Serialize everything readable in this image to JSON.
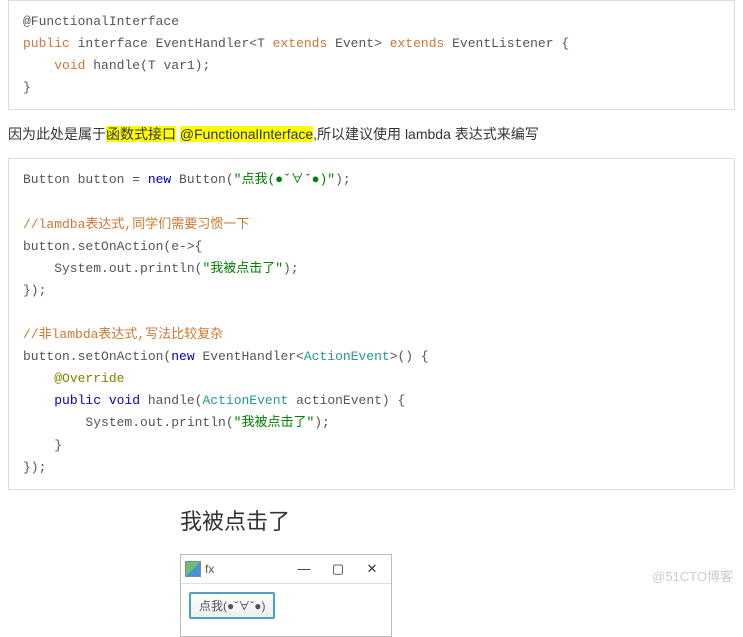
{
  "code1": {
    "l1_anno": "@FunctionalInterface",
    "l2a": "public",
    "l2b": " interface ",
    "l2c": "EventHandler",
    "l2d": "<T ",
    "l2e": "extends",
    "l2f": " Event> ",
    "l2g": "extends",
    "l2h": " EventListener {",
    "l3a": "    ",
    "l3b": "void",
    "l3c": " ",
    "l3d": "handle",
    "l3e": "(T var1);",
    "l4": "}"
  },
  "para1": {
    "pre": "因为此处是属于",
    "hl1": "函数式接口",
    "sp": " ",
    "hl2": "@FunctionalInterface",
    "post": ",所以建议使用 lambda 表达式来编写"
  },
  "code2": {
    "l1a": "Button button = ",
    "l1b": "new",
    "l1c": " Button(",
    "l1d": "\"点我(●ˇ∀ˇ●)\"",
    "l1e": ");",
    "blank": "",
    "c1a": "//lamdba表达式,同学们需要习惯一下",
    "l3a": "button.setOnAction(e->{",
    "l4a": "    System.out.println(",
    "l4b": "\"我被点击了\"",
    "l4c": ");",
    "l5": "});",
    "c2a": "//非",
    "c2b": "lambda",
    "c2c": "表达式,写法比较复杂",
    "l7a": "button.setOnAction(",
    "l7b": "new",
    "l7c": " EventHandler<",
    "l7d": "ActionEvent",
    "l7e": ">() {",
    "l8a": "    ",
    "l8b": "@Override",
    "l9a": "    ",
    "l9b": "public",
    "l9c": " ",
    "l9d": "void",
    "l9e": " handle(",
    "l9f": "ActionEvent",
    "l9g": " actionEvent) {",
    "l10a": "        System.out.println(",
    "l10b": "\"我被点击了\"",
    "l10c": ");",
    "l11": "    }",
    "l12": "});"
  },
  "output": "我被点击了",
  "window": {
    "title": "fx",
    "min": "—",
    "max": "▢",
    "close": "✕",
    "button_label": "点我(●ˇ∀ˇ●)"
  },
  "watermark": "@51CTO博客"
}
